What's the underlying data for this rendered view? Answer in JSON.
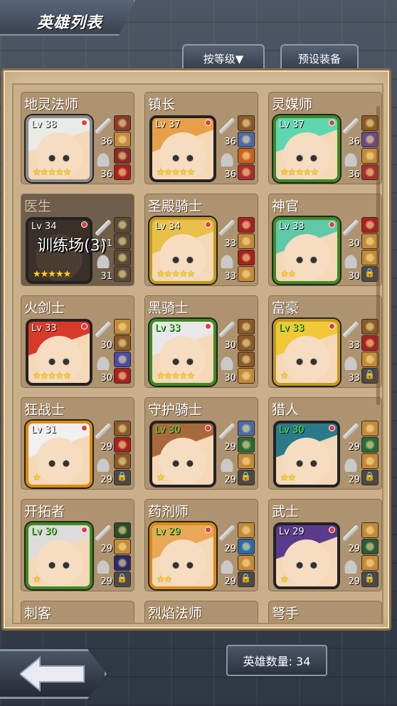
{
  "header": {
    "title": "英雄列表",
    "sort_button": "按等级▼",
    "preset_button": "预设装备"
  },
  "footer": {
    "hero_count": "英雄数量: 34"
  },
  "heroes": [
    {
      "name": "地灵法师",
      "level": "Lv 38",
      "stars": "★★★★★",
      "atk": "36",
      "def": "36",
      "frame": "gray",
      "lvcolor": "white",
      "hair": "#e9ece6",
      "eq": [
        "#8b3a2a",
        "#c28a3a",
        "#8a2a2a",
        "#a82020"
      ]
    },
    {
      "name": "镇长",
      "level": "Lv 37",
      "stars": "★★★★★",
      "atk": "36",
      "def": "36",
      "frame": "dark",
      "lvcolor": "white",
      "hair": "#e8a048",
      "eq": [
        "#8a5a2a",
        "#4a6aa8",
        "#c86020",
        "#a83030"
      ]
    },
    {
      "name": "灵媒师",
      "level": "Lv 37",
      "stars": "★★★★★",
      "atk": "36",
      "def": "36",
      "frame": "green",
      "lvcolor": "white",
      "hair": "#5ed7b0",
      "eq": [
        "#8a5a2a",
        "#6a4a8a",
        "#c28a3a",
        "#a83030"
      ]
    },
    {
      "name": "医生",
      "level": "Lv 34",
      "stars": "★★★★★",
      "atk": "31",
      "def": "31",
      "frame": "dark",
      "lvcolor": "white",
      "hair": "#5a4a3a",
      "eq": [
        "#5a4a3a",
        "#5a4a3a",
        "#5a4a3a",
        "#5a4a3a"
      ],
      "dim": true,
      "overlay": "训练场(3)"
    },
    {
      "name": "圣殿骑士",
      "level": "Lv 34",
      "stars": "★★★★★",
      "atk": "33",
      "def": "33",
      "frame": "gold",
      "lvcolor": "white",
      "hair": "#e8c048",
      "eq": [
        "#a82020",
        "#c28a3a",
        "#a82020",
        "#c28a3a"
      ]
    },
    {
      "name": "神官",
      "level": "Lv 33",
      "stars": "★★",
      "atk": "30",
      "def": "30",
      "frame": "green",
      "lvcolor": "white",
      "hair": "#5ec8a8",
      "eq": [
        "#a82020",
        "#c28a3a",
        "#c28a3a",
        "lock"
      ]
    },
    {
      "name": "火剑士",
      "level": "Lv 33",
      "stars": "★★★★★",
      "atk": "30",
      "def": "30",
      "frame": "dark",
      "lvcolor": "white",
      "hair": "#d83a2a",
      "eq": [
        "#c28a3a",
        "#8a5a2a",
        "#4a4aa8",
        "#a82020"
      ]
    },
    {
      "name": "黑骑士",
      "level": "Lv 33",
      "stars": "★★★★★",
      "atk": "30",
      "def": "30",
      "frame": "green",
      "lvcolor": "green",
      "hair": "#e8e8e8",
      "eq": [
        "#8a5a2a",
        "#8a5a2a",
        "#8a5a2a",
        "#c28a3a"
      ]
    },
    {
      "name": "富豪",
      "level": "Lv 33",
      "stars": "★",
      "atk": "33",
      "def": "33",
      "frame": "gold",
      "lvcolor": "green",
      "hair": "#f0c838",
      "eq": [
        "#8a5a2a",
        "#a82020",
        "#c28a3a",
        "lock"
      ]
    },
    {
      "name": "狂战士",
      "level": "Lv 31",
      "stars": "★",
      "atk": "29",
      "def": "29",
      "frame": "orange",
      "lvcolor": "white",
      "hair": "#f0f0f0",
      "eq": [
        "#8a5a2a",
        "#a82020",
        "#8a5a2a",
        "lock"
      ]
    },
    {
      "name": "守护骑士",
      "level": "Lv 30",
      "stars": "★",
      "atk": "29",
      "def": "29",
      "frame": "dark",
      "lvcolor": "green",
      "hair": "#a86a3a",
      "eq": [
        "#4a6aa8",
        "#2a6a3a",
        "#c28a3a",
        "lock"
      ]
    },
    {
      "name": "猎人",
      "level": "Lv 30",
      "stars": "★★",
      "atk": "29",
      "def": "29",
      "frame": "dark",
      "lvcolor": "green",
      "hair": "#2a7a8a",
      "eq": [
        "#c28a3a",
        "#2a6a3a",
        "#c28a3a",
        "lock"
      ]
    },
    {
      "name": "开拓者",
      "level": "Lv 30",
      "stars": "★",
      "atk": "29",
      "def": "29",
      "frame": "green",
      "lvcolor": "green",
      "hair": "#dcdcdc",
      "eq": [
        "#2a4a2a",
        "#c28a3a",
        "#2a2a6a",
        "lock"
      ]
    },
    {
      "name": "药剂师",
      "level": "Lv 29",
      "stars": "★★",
      "atk": "29",
      "def": "29",
      "frame": "orange",
      "lvcolor": "green",
      "hair": "#e8a858",
      "eq": [
        "#c28a3a",
        "#2a6aa8",
        "#c28a3a",
        "lock"
      ]
    },
    {
      "name": "武士",
      "level": "Lv 29",
      "stars": "★",
      "atk": "29",
      "def": "29",
      "frame": "dark",
      "lvcolor": "white",
      "hair": "#5a3a8a",
      "eq": [
        "#c28a3a",
        "#2a5a3a",
        "#c28a3a",
        "lock"
      ]
    },
    {
      "name": "刺客",
      "partial": true
    },
    {
      "name": "烈焰法师",
      "partial": true
    },
    {
      "name": "弩手",
      "partial": true
    }
  ]
}
